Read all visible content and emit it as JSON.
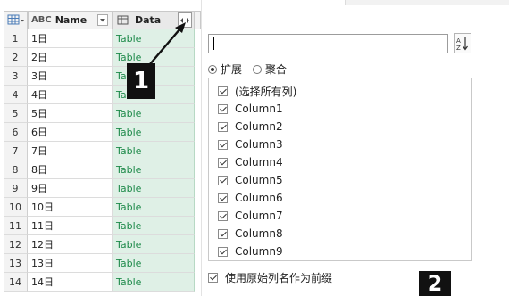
{
  "grid": {
    "columns": [
      {
        "type_icon": "ABC",
        "type_icon_sub": "C",
        "label": "Name"
      },
      {
        "type_icon": "table-icon",
        "label": "Data"
      }
    ],
    "rows": [
      {
        "idx": "1",
        "name": "1日",
        "data": "Table"
      },
      {
        "idx": "2",
        "name": "2日",
        "data": "Table"
      },
      {
        "idx": "3",
        "name": "3日",
        "data": "Table"
      },
      {
        "idx": "4",
        "name": "4日",
        "data": "Table"
      },
      {
        "idx": "5",
        "name": "5日",
        "data": "Table"
      },
      {
        "idx": "6",
        "name": "6日",
        "data": "Table"
      },
      {
        "idx": "7",
        "name": "7日",
        "data": "Table"
      },
      {
        "idx": "8",
        "name": "8日",
        "data": "Table"
      },
      {
        "idx": "9",
        "name": "9日",
        "data": "Table"
      },
      {
        "idx": "10",
        "name": "10日",
        "data": "Table"
      },
      {
        "idx": "11",
        "name": "11日",
        "data": "Table"
      },
      {
        "idx": "12",
        "name": "12日",
        "data": "Table"
      },
      {
        "idx": "13",
        "name": "13日",
        "data": "Table"
      },
      {
        "idx": "14",
        "name": "14日",
        "data": "Table"
      }
    ]
  },
  "panel": {
    "search_value": "",
    "radio_expand": "扩展",
    "radio_aggregate": "聚合",
    "selected_mode": "扩展",
    "columns": [
      {
        "label": "(选择所有列)",
        "checked": true
      },
      {
        "label": "Column1",
        "checked": true
      },
      {
        "label": "Column2",
        "checked": true
      },
      {
        "label": "Column3",
        "checked": true
      },
      {
        "label": "Column4",
        "checked": true
      },
      {
        "label": "Column5",
        "checked": true
      },
      {
        "label": "Column6",
        "checked": true
      },
      {
        "label": "Column7",
        "checked": true
      },
      {
        "label": "Column8",
        "checked": true
      },
      {
        "label": "Column9",
        "checked": true
      }
    ],
    "use_prefix_label": "使用原始列名作为前缀",
    "use_prefix_checked": true
  },
  "annotations": [
    {
      "label": "1"
    },
    {
      "label": "2"
    }
  ],
  "colors": {
    "table_text": "#1e8a4a",
    "data_col_bg": "#dff0e6",
    "marker_bg": "#111111"
  }
}
